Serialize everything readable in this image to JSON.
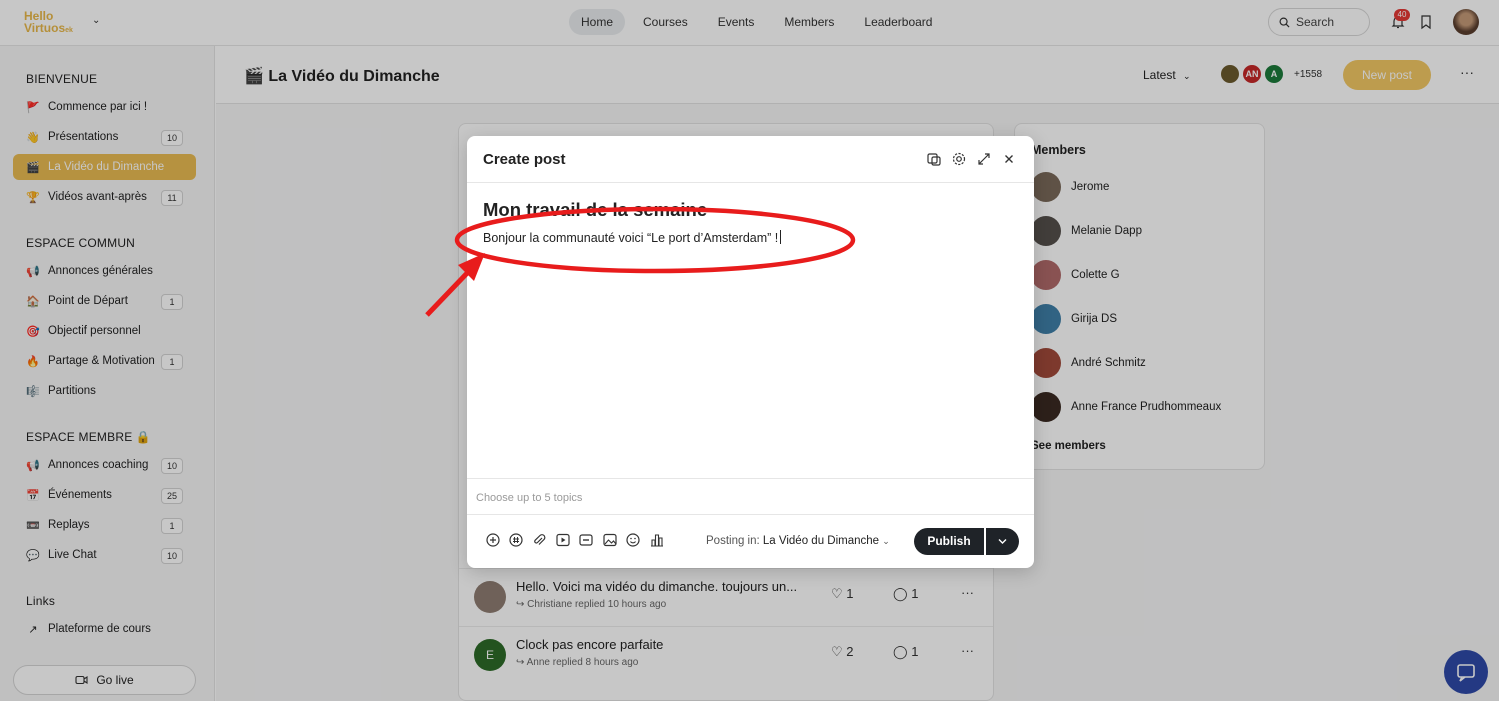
{
  "topbar": {
    "logo_line1": "Hello",
    "logo_line2": "Virtuos",
    "logo_suffix": "ek",
    "nav": [
      "Home",
      "Courses",
      "Events",
      "Members",
      "Leaderboard"
    ],
    "search_label": "Search",
    "notif_count": "40"
  },
  "sidebar": {
    "sections": [
      {
        "title": "BIENVENUE"
      },
      {
        "title": "ESPACE COMMUN"
      },
      {
        "title": "ESPACE MEMBRE 🔒"
      },
      {
        "title": "Links"
      }
    ],
    "items": [
      {
        "emoji": "🚩",
        "label": "Commence par ici !",
        "count": ""
      },
      {
        "emoji": "👋",
        "label": "Présentations",
        "count": "10"
      },
      {
        "emoji": "🎬",
        "label": "La Vidéo du Dimanche",
        "count": ""
      },
      {
        "emoji": "🏆",
        "label": "Vidéos avant-après",
        "count": "11"
      },
      {
        "emoji": "📢",
        "label": "Annonces générales",
        "count": ""
      },
      {
        "emoji": "🏠",
        "label": "Point de Départ",
        "count": "1"
      },
      {
        "emoji": "🎯",
        "label": "Objectif personnel",
        "count": ""
      },
      {
        "emoji": "🔥",
        "label": "Partage & Motivation",
        "count": "1"
      },
      {
        "emoji": "🎼",
        "label": "Partitions",
        "count": ""
      },
      {
        "emoji": "📢",
        "label": "Annonces coaching",
        "count": "10"
      },
      {
        "emoji": "📅",
        "label": "Événements",
        "count": "25"
      },
      {
        "emoji": "📼",
        "label": "Replays",
        "count": "1"
      },
      {
        "emoji": "💬",
        "label": "Live Chat",
        "count": "10"
      },
      {
        "emoji": "↗",
        "label": "Plateforme de cours",
        "count": ""
      }
    ],
    "go_live": "Go live"
  },
  "space": {
    "title_emoji": "🎬",
    "title": "La Vidéo du Dimanche",
    "sort": "Latest",
    "avatars": [
      "",
      "AN",
      "A"
    ],
    "member_more": "+1558",
    "new_post": "New post"
  },
  "members_panel": {
    "title": "Members",
    "members": [
      "Jerome",
      "Melanie Dapp",
      "Colette G",
      "Girija DS",
      "André Schmitz",
      "Anne France Prudhommeaux"
    ],
    "see_all": "See members"
  },
  "feed": [
    {
      "avatar_letter": "",
      "title": "Hello.  Voici ma vidéo  du dimanche. toujours un...",
      "meta": "Christiane replied 10 hours ago",
      "likes": "1",
      "comments": "1"
    },
    {
      "avatar_letter": "E",
      "title": "Clock pas encore parfaite",
      "meta": "Anne replied 8 hours ago",
      "likes": "2",
      "comments": "1"
    }
  ],
  "modal": {
    "title": "Create post",
    "post_title": "Mon travail de la semaine",
    "post_body": "Bonjour la communauté voici “Le port d’Amsterdam” !",
    "topics_placeholder": "Choose up to 5 topics",
    "posting_in_label": "Posting in:",
    "posting_in_space": "La Vidéo du Dimanche",
    "publish": "Publish"
  },
  "colors": {
    "accent": "#e9bc52",
    "annotation": "#e81c1c",
    "publish_bg": "#1f2328",
    "chat_bubble": "#2f4aa8"
  }
}
